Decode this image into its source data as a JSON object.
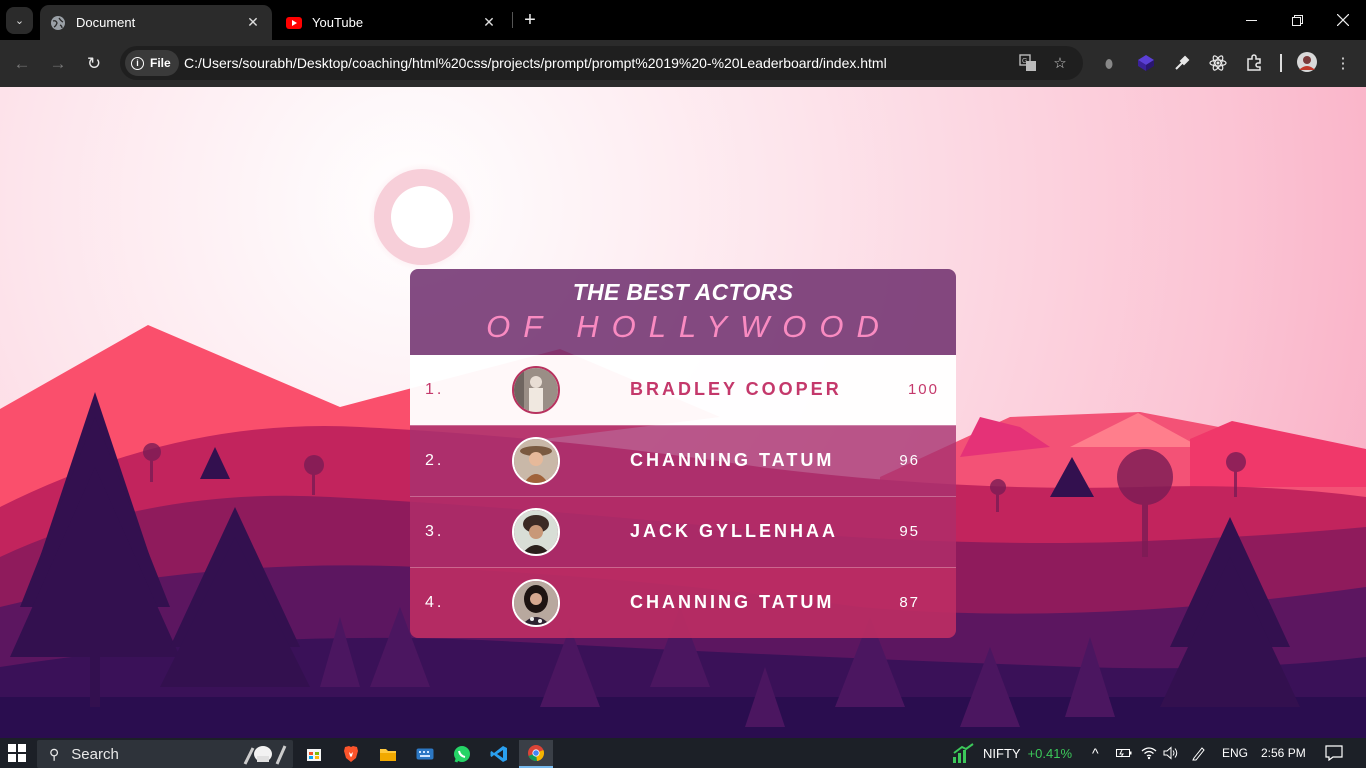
{
  "browser": {
    "tabs": [
      {
        "title": "Document",
        "active": true,
        "icon": "globe-icon"
      },
      {
        "title": "YouTube",
        "active": false,
        "icon": "youtube-icon"
      }
    ],
    "omnibox": {
      "site_chip": "File",
      "url": "C:/Users/sourabh/Desktop/coaching/html%20css/projects/prompt/prompt%2019%20-%20Leaderboard/index.html"
    }
  },
  "leaderboard": {
    "title_line1": "THE BEST ACTORS",
    "title_line2": "OF HOLLYWOOD",
    "rows": [
      {
        "rank": "1.",
        "name": "BRADLEY COOPER",
        "score": "100"
      },
      {
        "rank": "2.",
        "name": "CHANNING TATUM",
        "score": "96"
      },
      {
        "rank": "3.",
        "name": "JACK GYLLENHAA",
        "score": "95"
      },
      {
        "rank": "4.",
        "name": "CHANNING TATUM",
        "score": "87"
      }
    ]
  },
  "taskbar": {
    "search_placeholder": "Search",
    "nifty_label": "NIFTY",
    "nifty_change": "+0.41%",
    "language": "ENG",
    "time": "2:56 PM"
  },
  "colors": {
    "accent_pink": "#f98bc1",
    "highlight_text": "#c4386b",
    "header_purple": "#6f2f6e",
    "nifty_green": "#3cc85a"
  }
}
